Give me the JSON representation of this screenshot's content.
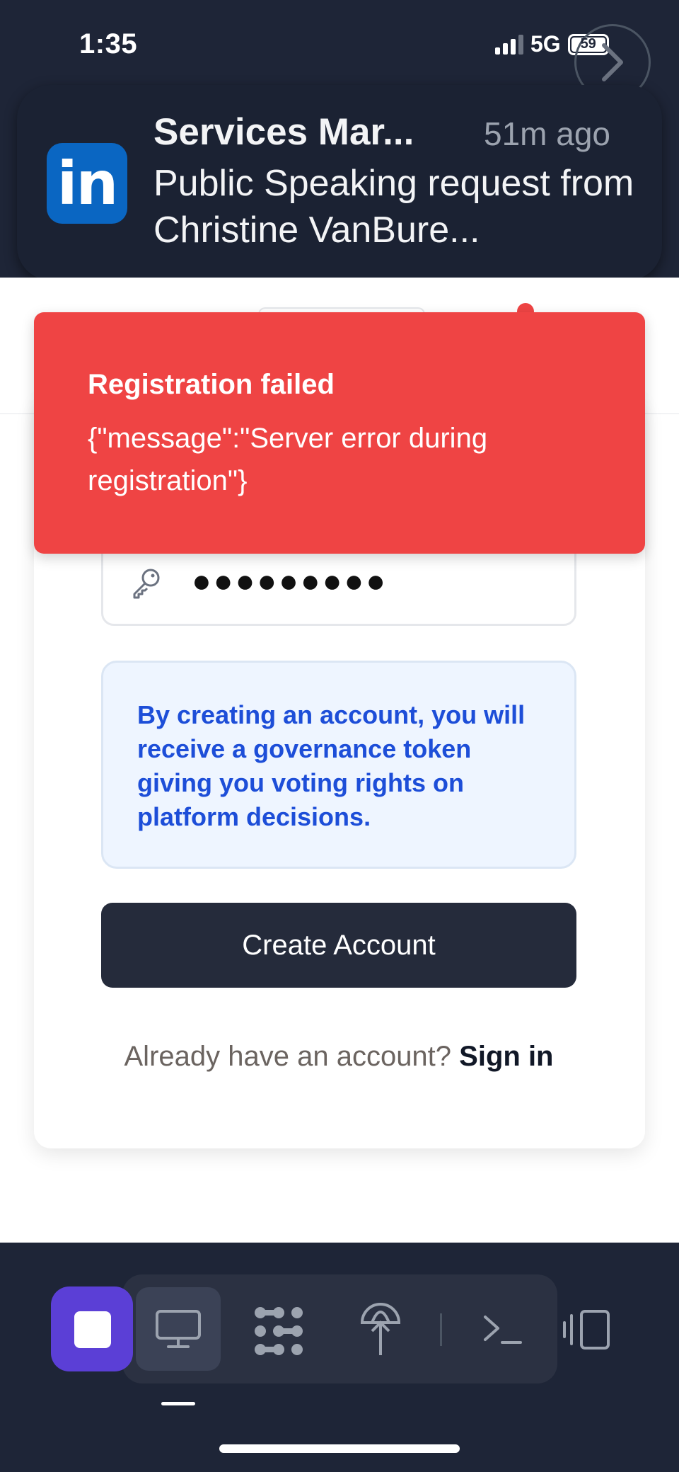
{
  "status_bar": {
    "time": "1:35",
    "network": "5G",
    "battery": "59"
  },
  "notification": {
    "app_icon": "linkedin-logo",
    "logo_text": "in",
    "title": "Services Mar...",
    "time": "51m ago",
    "body": "Public Speaking request from Christine VanBure..."
  },
  "toast": {
    "title": "Registration failed",
    "message": "{\"message\":\"Server error during registration\"}",
    "color": "#ef4444"
  },
  "form": {
    "password_value": "●●●●●●●●●",
    "password_icon": "key-icon",
    "info_text": "By creating an account, you will receive a governance token giving you voting rights on platform decisions.",
    "submit_label": "Create Account",
    "signin_prompt": "Already have an account?",
    "signin_link": "Sign in"
  },
  "bottom_toolbar": {
    "icons": [
      "stop-icon",
      "monitor-icon",
      "apps-grid-icon",
      "globe-antenna-icon",
      "terminal-icon",
      "split-panel-icon"
    ],
    "accent": "#5b3fd6"
  }
}
